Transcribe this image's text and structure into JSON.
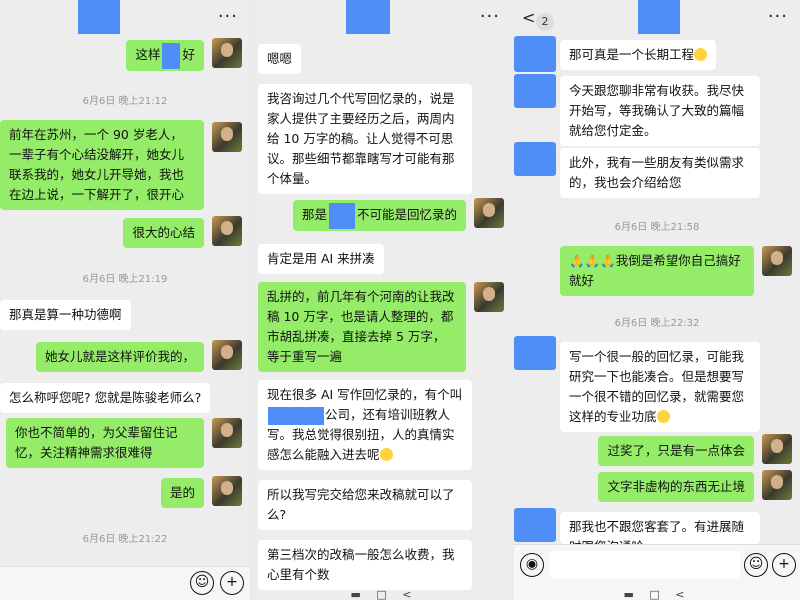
{
  "panel1": {
    "menu": "···",
    "msg1_a": "这样",
    "msg1_b": "好",
    "time1": "6月6日 晚上21:12",
    "msg2": "前年在苏州，一个 90 岁老人，一辈子有个心结没解开，她女儿联系我的，她女儿开导她，我也在边上说，一下解开了，很开心",
    "msg3": "很大的心结",
    "time2": "6月6日 晚上21:19",
    "msg4": "那真是算一种功德啊",
    "msg5": "她女儿就是这样评价我的，",
    "msg6": "怎么称呼您呢? 您就是陈骏老师么?",
    "msg7": "你也不简单的，为父辈留住记忆，关注精神需求很难得",
    "msg8": "是的",
    "time3": "6月6日 晚上21:22"
  },
  "panel2": {
    "menu": "···",
    "msg1": "嗯嗯",
    "msg2": "我咨询过几个代写回忆录的，说是家人提供了主要经历之后，两周内给 10 万字的稿。让人觉得不可思议。那些细节都靠瞎写才可能有那个体量。",
    "msg3_a": "那是",
    "msg3_b": "不可能是回忆录的",
    "msg4": "肯定是用 AI 来拼凑",
    "msg5": "乱拼的，前几年有个河南的让我改稿 10 万字，也是请人整理的，都市胡乱拼凑，直接去掉 5 万字，等于重写一遍",
    "msg6_a": "现在很多 AI 写作回忆录的，有个叫",
    "msg6_b": "公司，还有培训班教人写。我总觉得很别扭，人的真情实感怎么能融入进去呢",
    "msg7": "所以我写完交给您来改稿就可以了么?",
    "msg8": "第三档次的改稿一般怎么收费，我心里有个数"
  },
  "panel3": {
    "back": "<",
    "badge": "2",
    "menu": "···",
    "msg1": "那可真是一个长期工程",
    "msg2": "今天跟您聊非常有收获。我尽快开始写，等我确认了大致的篇幅就给您付定金。",
    "msg3": "此外，我有一些朋友有类似需求的，我也会介绍给您",
    "time1": "6月6日 晚上21:58",
    "msg4_emoji": "🙏🙏🙏",
    "msg4": "我倒是希望你自己搞好就好",
    "time2": "6月6日 晚上22:32",
    "msg5": "写一个很一般的回忆录，可能我研究一下也能凑合。但是想要写一个很不错的回忆录，就需要您这样的专业功底",
    "msg6": "过奖了，只是有一点体会",
    "msg7": "文字非虚构的东西无止境",
    "msg8": "那我也不跟您客套了。有进展随时跟您沟通哈"
  },
  "input": {
    "emoji_icon": "☺",
    "plus_icon": "+",
    "voice_icon": "◉"
  },
  "nav": {
    "left": "▬",
    "home": "□",
    "back": "<"
  }
}
